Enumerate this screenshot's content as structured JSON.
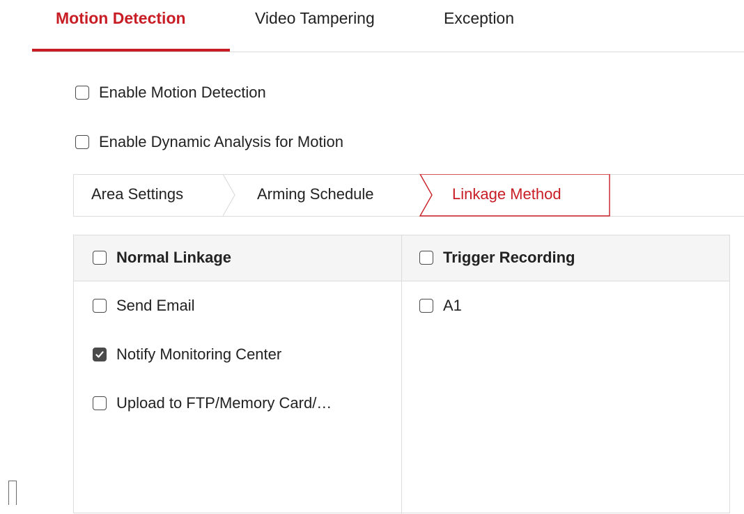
{
  "tabs": [
    {
      "label": "Motion Detection",
      "active": true
    },
    {
      "label": "Video Tampering",
      "active": false
    },
    {
      "label": "Exception",
      "active": false
    }
  ],
  "options": {
    "enable_motion_detection": {
      "label": "Enable Motion Detection",
      "checked": false
    },
    "enable_dynamic_analysis": {
      "label": "Enable Dynamic Analysis for Motion",
      "checked": false
    }
  },
  "sub_tabs": [
    {
      "label": "Area Settings",
      "active": false
    },
    {
      "label": "Arming Schedule",
      "active": false
    },
    {
      "label": "Linkage Method",
      "active": true
    }
  ],
  "linkage_table": {
    "normal_linkage": {
      "header": "Normal Linkage",
      "checked": false,
      "items": [
        {
          "label": "Send Email",
          "checked": false
        },
        {
          "label": "Notify Monitoring Center",
          "checked": true
        },
        {
          "label": "Upload to FTP/Memory Card/…",
          "checked": false
        }
      ]
    },
    "trigger_recording": {
      "header": "Trigger Recording",
      "checked": false,
      "items": [
        {
          "label": "A1",
          "checked": false
        }
      ]
    }
  },
  "colors": {
    "accent": "#c81d25",
    "border": "#dcdcdc",
    "header_bg": "#f5f5f5",
    "checkbox": "#4a4a4a"
  }
}
